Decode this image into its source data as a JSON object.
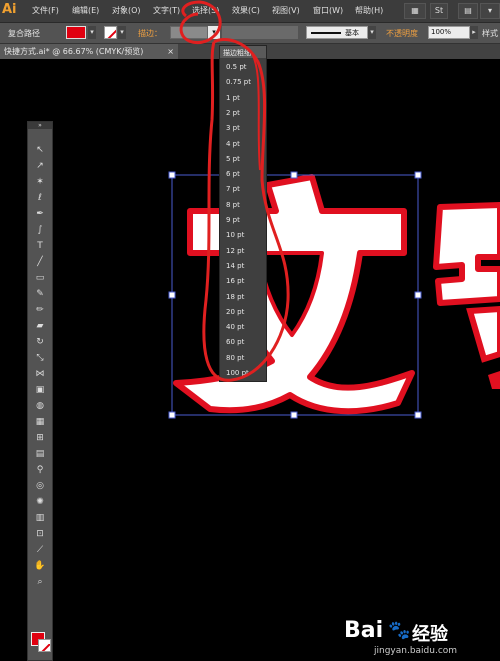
{
  "app": {
    "logo": "Ai"
  },
  "menubar": {
    "items": [
      "文件(F)",
      "编辑(E)",
      "对象(O)",
      "文字(T)",
      "选择(S)",
      "效果(C)",
      "视图(V)",
      "窗口(W)",
      "帮助(H)"
    ],
    "extra": "St"
  },
  "control_bar": {
    "path_label": "复合路径",
    "stroke_label": "描边：",
    "stroke_value": "",
    "profile_label": "基本",
    "opacity_label": "不透明度",
    "opacity_value": "100%",
    "style_label": "样式"
  },
  "document": {
    "tab_title": "快捷方式.ai* @ 66.67% (CMYK/预览)"
  },
  "dropdown": {
    "header": "描边粗细",
    "options": [
      "0.5 pt",
      "0.75 pt",
      "1 pt",
      "2 pt",
      "3 pt",
      "4 pt",
      "5 pt",
      "6 pt",
      "7 pt",
      "8 pt",
      "9 pt",
      "10 pt",
      "12 pt",
      "14 pt",
      "16 pt",
      "18 pt",
      "20 pt",
      "40 pt",
      "60 pt",
      "80 pt",
      "100 pt"
    ]
  },
  "canvas": {
    "main_char": "文",
    "fill_color": "#ffffff",
    "stroke_color": "#e01020",
    "selection_color": "#4a5cd0"
  },
  "watermark": {
    "brand": "Bai",
    "brand2": "经验",
    "url": "jingyan.baidu.com"
  },
  "colors": {
    "swatch_fill": "#e00010",
    "annotation": "#e02020"
  }
}
